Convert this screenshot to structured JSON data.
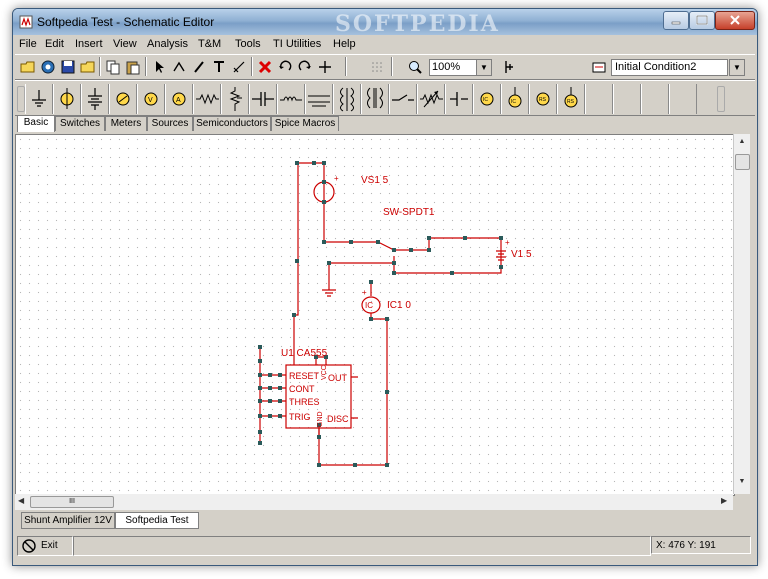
{
  "window": {
    "title": "Softpedia Test - Schematic Editor",
    "watermark": "SOFTPEDIA",
    "buttons": [
      "minimize",
      "maximize",
      "close"
    ]
  },
  "menu": [
    "File",
    "Edit",
    "Insert",
    "View",
    "Analysis",
    "T&M",
    "Tools",
    "TI Utilities",
    "Help"
  ],
  "toolbar": {
    "zoom_value": "100%",
    "initial_condition": "Initial Condition2",
    "icons": [
      "open-folder-icon",
      "open-icon",
      "save-icon",
      "open-folder-icon",
      "copy-icon",
      "paste-icon",
      "pointer-icon",
      "wire-icon",
      "pen-icon",
      "text-icon",
      "measure-icon",
      "delete-icon",
      "undo-icon",
      "redo-icon",
      "junction-icon",
      "grid-icon",
      "zoom-icon",
      "probe-icon",
      "initial-condition-icon"
    ]
  },
  "components_bar": {
    "icons": [
      "ground",
      "voltage-source",
      "battery",
      "current-source",
      "voltmeter",
      "ammeter",
      "resistor",
      "potentiometer",
      "capacitor",
      "inductor",
      "transformer",
      "coupled-inductor",
      "diode",
      "switch",
      "variable-resistor",
      "capacitor-polarized",
      "ic1",
      "ic2",
      "ic3",
      "ic4"
    ]
  },
  "tabs": [
    "Basic",
    "Switches",
    "Meters",
    "Sources",
    "Semiconductors",
    "Spice Macros"
  ],
  "schematic": {
    "labels": {
      "vs": "VS1 5",
      "sw": "SW-SPDT1",
      "v1": "V1 5",
      "ic_src": "IC",
      "ic_label": "IC1 0",
      "u1": "U1 CA555",
      "pins_left": [
        "RESET",
        "CONT",
        "THRES",
        "TRIG"
      ],
      "pins_right": [
        "OUT",
        "DISC"
      ],
      "pin_gnd": "GND",
      "pin_vcc": "VCC",
      "plus": "+",
      "plus2": "+",
      "plus3": "+"
    }
  },
  "sheet_tabs": [
    "Shunt Amplifier 12V",
    "Softpedia Test"
  ],
  "hscroll_grip": "III",
  "status": {
    "exit_label": "Exit",
    "coords": "X: 476  Y: 191"
  },
  "colors": {
    "schematic": "#cc0000",
    "node": "#2a5a5a",
    "titlebar": "#8fb0d3"
  }
}
